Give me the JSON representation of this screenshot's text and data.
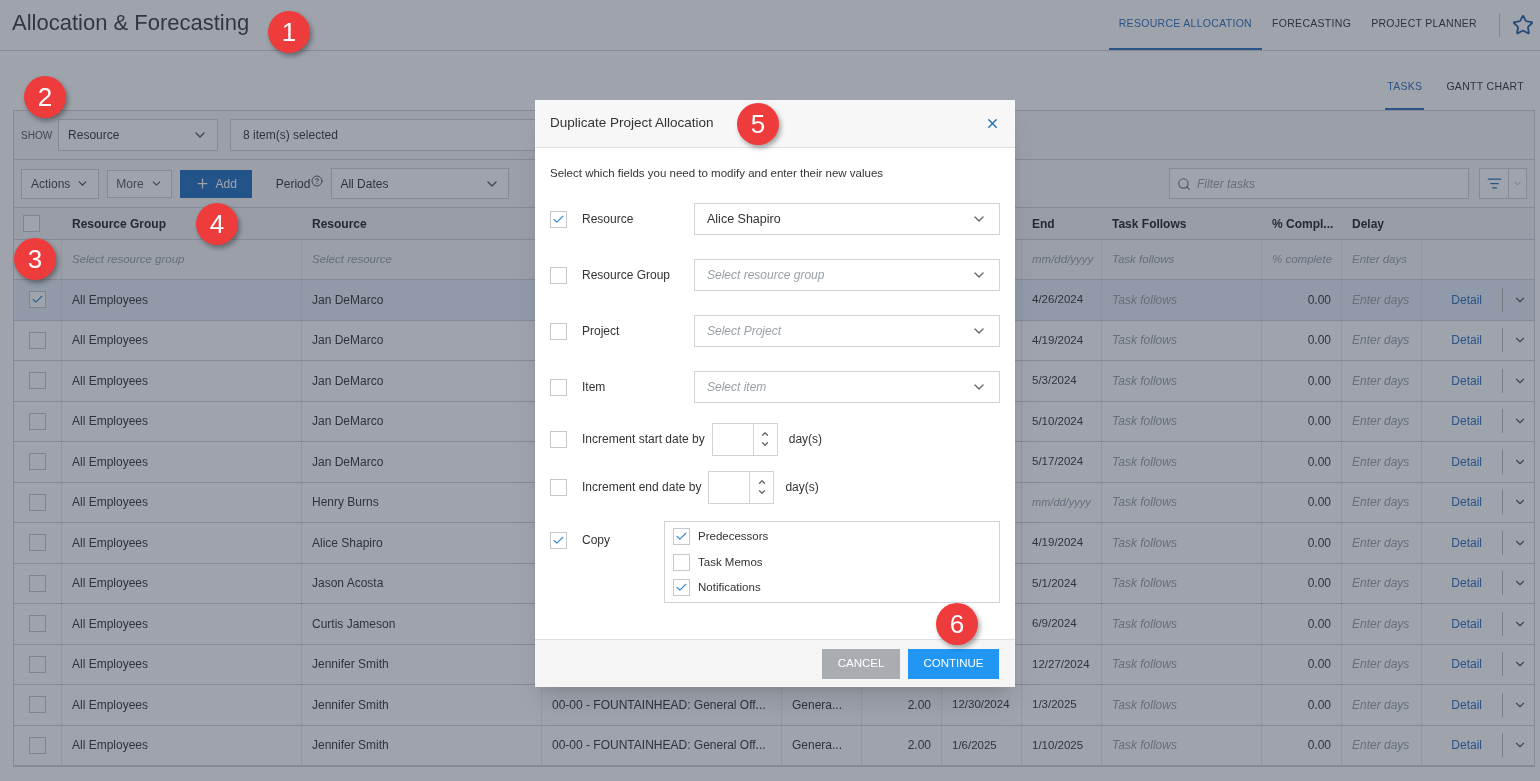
{
  "header": {
    "title": "Allocation & Forecasting",
    "nav": [
      {
        "label": "RESOURCE ALLOCATION",
        "selected": true
      },
      {
        "label": "FORECASTING",
        "selected": false
      },
      {
        "label": "PROJECT PLANNER",
        "selected": false
      }
    ]
  },
  "subtabs": [
    {
      "label": "TASKS",
      "selected": true
    },
    {
      "label": "GANTT CHART",
      "selected": false
    }
  ],
  "toolbar": {
    "show_label": "SHOW",
    "show_value": "Resource",
    "selection_text": "8 item(s) selected",
    "actions_label": "Actions",
    "more_label": "More",
    "add_label": "Add",
    "period_label": "Period",
    "period_value": "All Dates",
    "filter_placeholder": "Filter tasks"
  },
  "table": {
    "header_checked": false,
    "columns": [
      "Resource Group",
      "Resource",
      "End",
      "Task Follows",
      "% Compl...",
      "Delay"
    ],
    "filter_placeholders": [
      "Select resource group",
      "Select resource",
      "mm/dd/yyyy",
      "Task follows",
      "% complete",
      "Enter days"
    ],
    "rows": [
      {
        "selected": true,
        "resource_group": "All Employees",
        "resource": "Jan DeMarco",
        "end": "4/26/2024",
        "task_follows": "Task follows",
        "complete": "0.00",
        "delay": "Enter days",
        "action": "Detail"
      },
      {
        "selected": false,
        "resource_group": "All Employees",
        "resource": "Jan DeMarco",
        "end": "4/19/2024",
        "task_follows": "Task follows",
        "complete": "0.00",
        "delay": "Enter days",
        "action": "Detail"
      },
      {
        "selected": false,
        "resource_group": "All Employees",
        "resource": "Jan DeMarco",
        "end": "5/3/2024",
        "task_follows": "Task follows",
        "complete": "0.00",
        "delay": "Enter days",
        "action": "Detail"
      },
      {
        "selected": false,
        "resource_group": "All Employees",
        "resource": "Jan DeMarco",
        "end": "5/10/2024",
        "task_follows": "Task follows",
        "complete": "0.00",
        "delay": "Enter days",
        "action": "Detail"
      },
      {
        "selected": false,
        "resource_group": "All Employees",
        "resource": "Jan DeMarco",
        "end": "5/17/2024",
        "task_follows": "Task follows",
        "complete": "0.00",
        "delay": "Enter days",
        "action": "Detail"
      },
      {
        "selected": false,
        "resource_group": "All Employees",
        "resource": "Henry Burns",
        "end_placeholder": "mm/dd/yyyy",
        "task_follows": "Task follows",
        "complete": "0.00",
        "delay": "Enter days",
        "action": "Detail"
      },
      {
        "selected": false,
        "resource_group": "All Employees",
        "resource": "Alice Shapiro",
        "end": "4/19/2024",
        "task_follows": "Task follows",
        "complete": "0.00",
        "delay": "Enter days",
        "action": "Detail"
      },
      {
        "selected": false,
        "resource_group": "All Employees",
        "resource": "Jason Acosta",
        "end": "5/1/2024",
        "task_follows": "Task follows",
        "complete": "0.00",
        "delay": "Enter days",
        "action": "Detail"
      },
      {
        "selected": false,
        "resource_group": "All Employees",
        "resource": "Curtis Jameson",
        "end": "6/9/2024",
        "task_follows": "Task follows",
        "complete": "0.00",
        "delay": "Enter days",
        "action": "Detail"
      },
      {
        "selected": false,
        "resource_group": "All Employees",
        "resource": "Jennifer Smith",
        "end": "12/27/2024",
        "task_follows": "Task follows",
        "complete": "0.00",
        "delay": "Enter days",
        "action": "Detail"
      },
      {
        "selected": false,
        "resource_group": "All Employees",
        "resource": "Jennifer Smith",
        "project": "00-00 - FOUNTAINHEAD: General Off...",
        "item": "Genera...",
        "hours": "2.00",
        "start": "12/30/2024",
        "end": "1/3/2025",
        "task_follows": "Task follows",
        "complete": "0.00",
        "delay": "Enter days",
        "action": "Detail"
      },
      {
        "selected": false,
        "resource_group": "All Employees",
        "resource": "Jennifer Smith",
        "project": "00-00 - FOUNTAINHEAD: General Off...",
        "item": "Genera...",
        "hours": "2.00",
        "start": "1/6/2025",
        "end": "1/10/2025",
        "task_follows": "Task follows",
        "complete": "0.00",
        "delay": "Enter days",
        "action": "Detail"
      }
    ]
  },
  "dialog": {
    "title": "Duplicate Project Allocation",
    "intro": "Select which fields you need to modify and enter their new values",
    "fields": [
      {
        "kind": "select",
        "label": "Resource",
        "checked": true,
        "value": "Alice Shapiro"
      },
      {
        "kind": "select",
        "label": "Resource Group",
        "checked": false,
        "placeholder": "Select resource group"
      },
      {
        "kind": "select",
        "label": "Project",
        "checked": false,
        "placeholder": "Select Project"
      },
      {
        "kind": "select",
        "label": "Item",
        "checked": false,
        "placeholder": "Select item"
      },
      {
        "kind": "stepper",
        "label": "Increment start date by",
        "checked": false,
        "unit": "day(s)"
      },
      {
        "kind": "stepper",
        "label": "Increment end date by",
        "checked": false,
        "unit": "day(s)"
      },
      {
        "kind": "copy",
        "label": "Copy",
        "checked": true,
        "options": [
          {
            "label": "Predecessors",
            "checked": true
          },
          {
            "label": "Task Memos",
            "checked": false
          },
          {
            "label": "Notifications",
            "checked": true
          }
        ]
      }
    ],
    "cancel": "CANCEL",
    "continue": "CONTINUE"
  },
  "callouts": [
    "1",
    "2",
    "3",
    "4",
    "5",
    "6"
  ]
}
